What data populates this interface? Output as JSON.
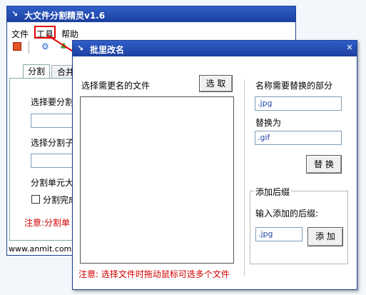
{
  "back_window": {
    "title": "大文件分割精灵v1.6",
    "menu": [
      "文件",
      "工具",
      "帮助"
    ],
    "tabs": [
      "分割",
      "合并"
    ],
    "label_select_file": "选择要分割",
    "label_select_dir": "选择分割子",
    "label_unit": "分割单元大",
    "checkbox_label": "分割完成",
    "note": "注意:分割单",
    "footer": "www.anmit.com"
  },
  "dialog": {
    "title": "批里改名",
    "select_label": "选择需更名的文件",
    "select_button": "选 取",
    "replace_part_label": "名称需要替换的部分",
    "replace_part_value": ".jpg",
    "replace_with_label": "替换为",
    "replace_with_value": ".gif",
    "replace_button": "替 换",
    "add_suffix_group": "添加后缀",
    "add_suffix_prompt": "输入添加的后缀:",
    "add_suffix_value": ".jpg",
    "add_button": "添 加",
    "note": "注意: 选择文件时拖动鼠标可选多个文件"
  },
  "colors": {
    "titlebar": "#1c3fa0",
    "highlight_box": "#e00000",
    "note_red": "#d00000"
  }
}
